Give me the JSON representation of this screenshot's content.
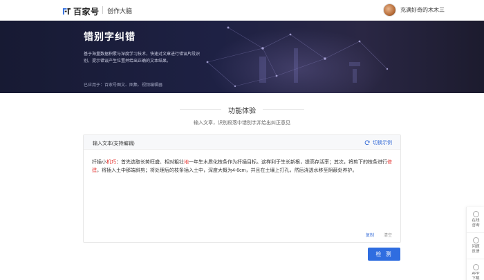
{
  "header": {
    "logo_text": "百家号",
    "logo_sub": "创作大脑",
    "user_name": "充满好奇的木木三"
  },
  "hero": {
    "title": "错别字纠错",
    "description": "基于海量数据积累与深度学习技术，快速对文章进行错误片段识别，提示错误产生位置并给出正确的文本结果。",
    "applied": "已应用于：百家号图文、图集、视频编辑器"
  },
  "section": {
    "title": "功能体验",
    "description": "输入文章，识别段落中错别字并给出纠正意见"
  },
  "editor": {
    "label": "输入文本(支持编辑)",
    "switch_label": "切换示例",
    "segments": [
      {
        "text": "扦插小",
        "error": false
      },
      {
        "text": "机巧",
        "error": true
      },
      {
        "text": "：首先选取长势旺盛、相对粗壮",
        "error": false
      },
      {
        "text": "地",
        "error": true
      },
      {
        "text": "一年生木质化枝条作为扦插目标。这样利于生长新根，提高存活率；其次，将剪下的枝条进行",
        "error": false
      },
      {
        "text": "修建",
        "error": true
      },
      {
        "text": "，将插入土中那端斜剪；将处理后的枝条插入土中，深度大概为4-6cm，并且在土壤上打孔，然后浇透水移至阴蔽处养护。",
        "error": false
      }
    ],
    "copy_label": "复制",
    "clear_label": "清空"
  },
  "check_button": "检 测",
  "side_tools": [
    {
      "label": "在线咨询",
      "icon": "chat-icon"
    },
    {
      "label": "问题反馈",
      "icon": "feedback-icon"
    },
    {
      "label": "APP下载",
      "icon": "app-icon"
    }
  ],
  "colors": {
    "accent": "#2f6de0",
    "error": "#e5332f",
    "hero_bg": "#1e2144"
  }
}
